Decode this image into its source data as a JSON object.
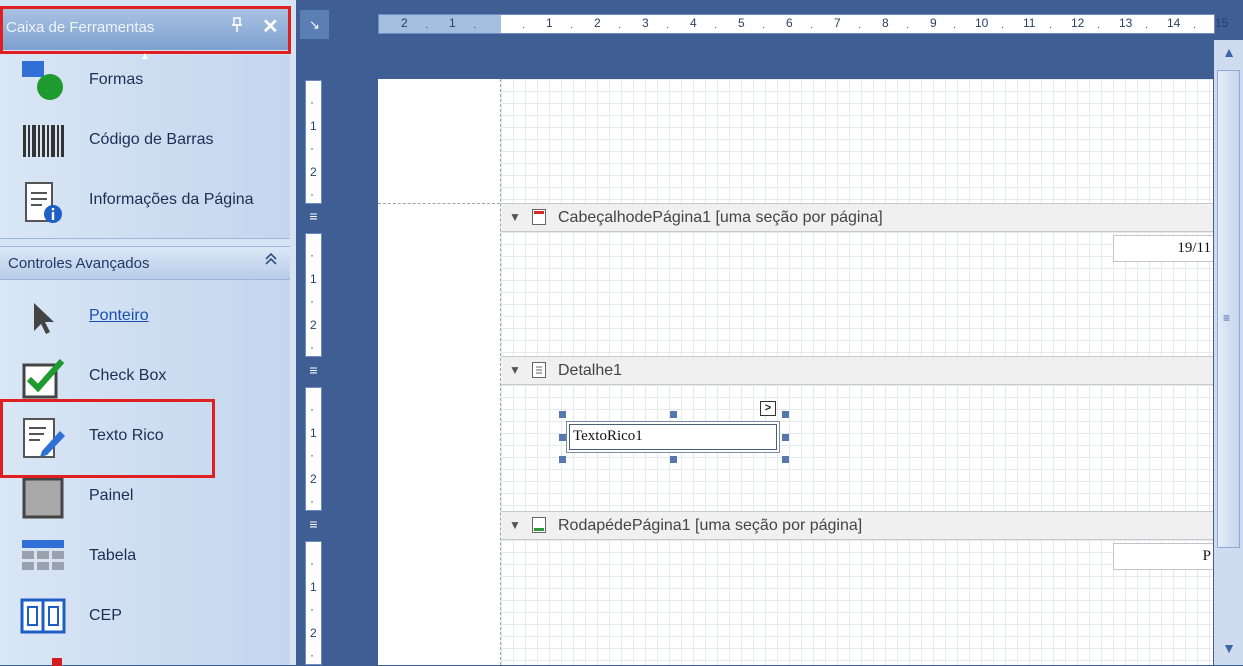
{
  "toolbox": {
    "title": "Caixa de Ferramentas",
    "pin_glyph": "📌",
    "close_glyph": "✕",
    "group1_items": [
      {
        "label": "Formas",
        "icon": "shapes-icon"
      },
      {
        "label": "Código de Barras",
        "icon": "barcode-icon"
      },
      {
        "label": "Informações da Página",
        "icon": "page-info-icon"
      }
    ],
    "group2_title": "Controles Avançados",
    "group2_items": [
      {
        "label": "Ponteiro",
        "icon": "pointer-icon"
      },
      {
        "label": "Check Box",
        "icon": "checkbox-icon"
      },
      {
        "label": "Texto Rico",
        "icon": "rich-text-icon"
      },
      {
        "label": "Painel",
        "icon": "panel-icon"
      },
      {
        "label": "Tabela",
        "icon": "table-icon"
      },
      {
        "label": "CEP",
        "icon": "zipcode-icon"
      }
    ]
  },
  "ruler": {
    "negatives": [
      "2",
      "1"
    ],
    "positives": [
      "1",
      "2",
      "3",
      "4",
      "5",
      "6",
      "7",
      "8",
      "9",
      "10",
      "11",
      "12",
      "13",
      "14",
      "15"
    ],
    "vertical": [
      "1",
      "2"
    ]
  },
  "designer": {
    "bands": [
      {
        "label": "CabeçalhodePágina1 [uma seção por página]",
        "icon": "page-header-band-icon"
      },
      {
        "label": "Detalhe1",
        "icon": "detail-band-icon"
      },
      {
        "label": "RodapédePágina1 [uma seção por página]",
        "icon": "page-footer-band-icon"
      }
    ],
    "header_field_text": "19/11",
    "footer_field_text": "P",
    "rich_text_control": "TextoRico1",
    "smart_tag_glyph": ">"
  },
  "colors": {
    "highlight": "#e02020",
    "background": "#3f5f94",
    "toolbox": "#d6e3f3"
  }
}
